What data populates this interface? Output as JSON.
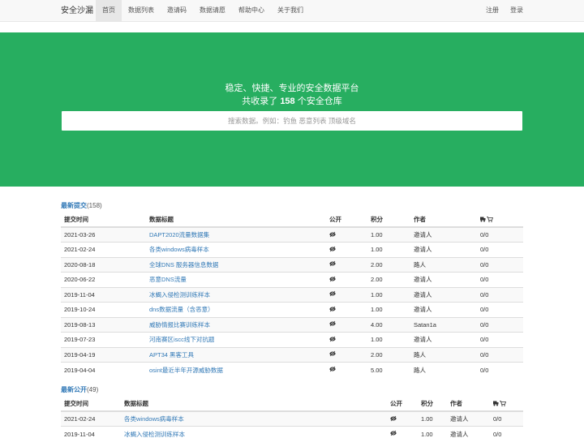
{
  "navbar": {
    "brand": "安全沙漏",
    "items": [
      {
        "label": "首页",
        "active": true
      },
      {
        "label": "数据列表",
        "active": false
      },
      {
        "label": "邀请码",
        "active": false
      },
      {
        "label": "数据请愿",
        "active": false
      },
      {
        "label": "帮助中心",
        "active": false
      },
      {
        "label": "关于我们",
        "active": false
      }
    ],
    "right": [
      {
        "label": "注册"
      },
      {
        "label": "登录"
      }
    ]
  },
  "hero": {
    "line1": "稳定、快捷、专业的安全数据平台",
    "line2_pre": "共收录了 ",
    "line2_count": "158",
    "line2_post": " 个安全仓库",
    "search_placeholder": "搜索数据。例如：钓鱼 恶意列表 顶级域名"
  },
  "latest_submit": {
    "title": "最新提交",
    "count": "(158)",
    "headers": [
      "提交时间",
      "数据标题",
      "公开",
      "积分",
      "作者"
    ],
    "rows": [
      {
        "date": "2021-03-26",
        "title": "DAPT2020流量数据集",
        "points": "1.00",
        "author": "邀请人",
        "stats": "0/0"
      },
      {
        "date": "2021-02-24",
        "title": "各类windows病毒样本",
        "points": "1.00",
        "author": "邀请人",
        "stats": "0/0"
      },
      {
        "date": "2020-08-18",
        "title": "全球DNS 服务器信息数据",
        "points": "2.00",
        "author": "路人",
        "stats": "0/0"
      },
      {
        "date": "2020-06-22",
        "title": "恶意DNS流量",
        "points": "2.00",
        "author": "邀请人",
        "stats": "0/0"
      },
      {
        "date": "2019-11-04",
        "title": "冰蝎入侵检测训练样本",
        "points": "1.00",
        "author": "邀请人",
        "stats": "0/0"
      },
      {
        "date": "2019-10-24",
        "title": "dns数据流量（含恶意）",
        "points": "1.00",
        "author": "邀请人",
        "stats": "0/0"
      },
      {
        "date": "2019-08-13",
        "title": "威胁情报比赛训练样本",
        "points": "4.00",
        "author": "Satan1a",
        "stats": "0/0"
      },
      {
        "date": "2019-07-23",
        "title": "河南赛区iscc线下对抗题",
        "points": "1.00",
        "author": "邀请人",
        "stats": "0/0"
      },
      {
        "date": "2019-04-19",
        "title": "APT34 黑客工具",
        "points": "2.00",
        "author": "路人",
        "stats": "0/0"
      },
      {
        "date": "2019-04-04",
        "title": "osint最近半年开源威胁数据",
        "points": "5.00",
        "author": "路人",
        "stats": "0/0"
      }
    ]
  },
  "latest_public": {
    "title": "最新公开",
    "count": "(49)",
    "headers": [
      "提交时间",
      "数据标题",
      "公开",
      "积分",
      "作者"
    ],
    "rows": [
      {
        "date": "2021-02-24",
        "title": "各类windows病毒样本",
        "points": "1.00",
        "author": "邀请人",
        "stats": "0/0"
      },
      {
        "date": "2019-11-04",
        "title": "冰蝎入侵检测训练样本",
        "points": "1.00",
        "author": "邀请人",
        "stats": "0/0"
      }
    ]
  },
  "colors": {
    "hero_green": "#27ae60",
    "link_blue": "#337ab7",
    "navbar_bg": "#f8f8f8"
  },
  "icons": {
    "public_column": "eye-icon",
    "stats_column": "truck-cart-icon"
  }
}
